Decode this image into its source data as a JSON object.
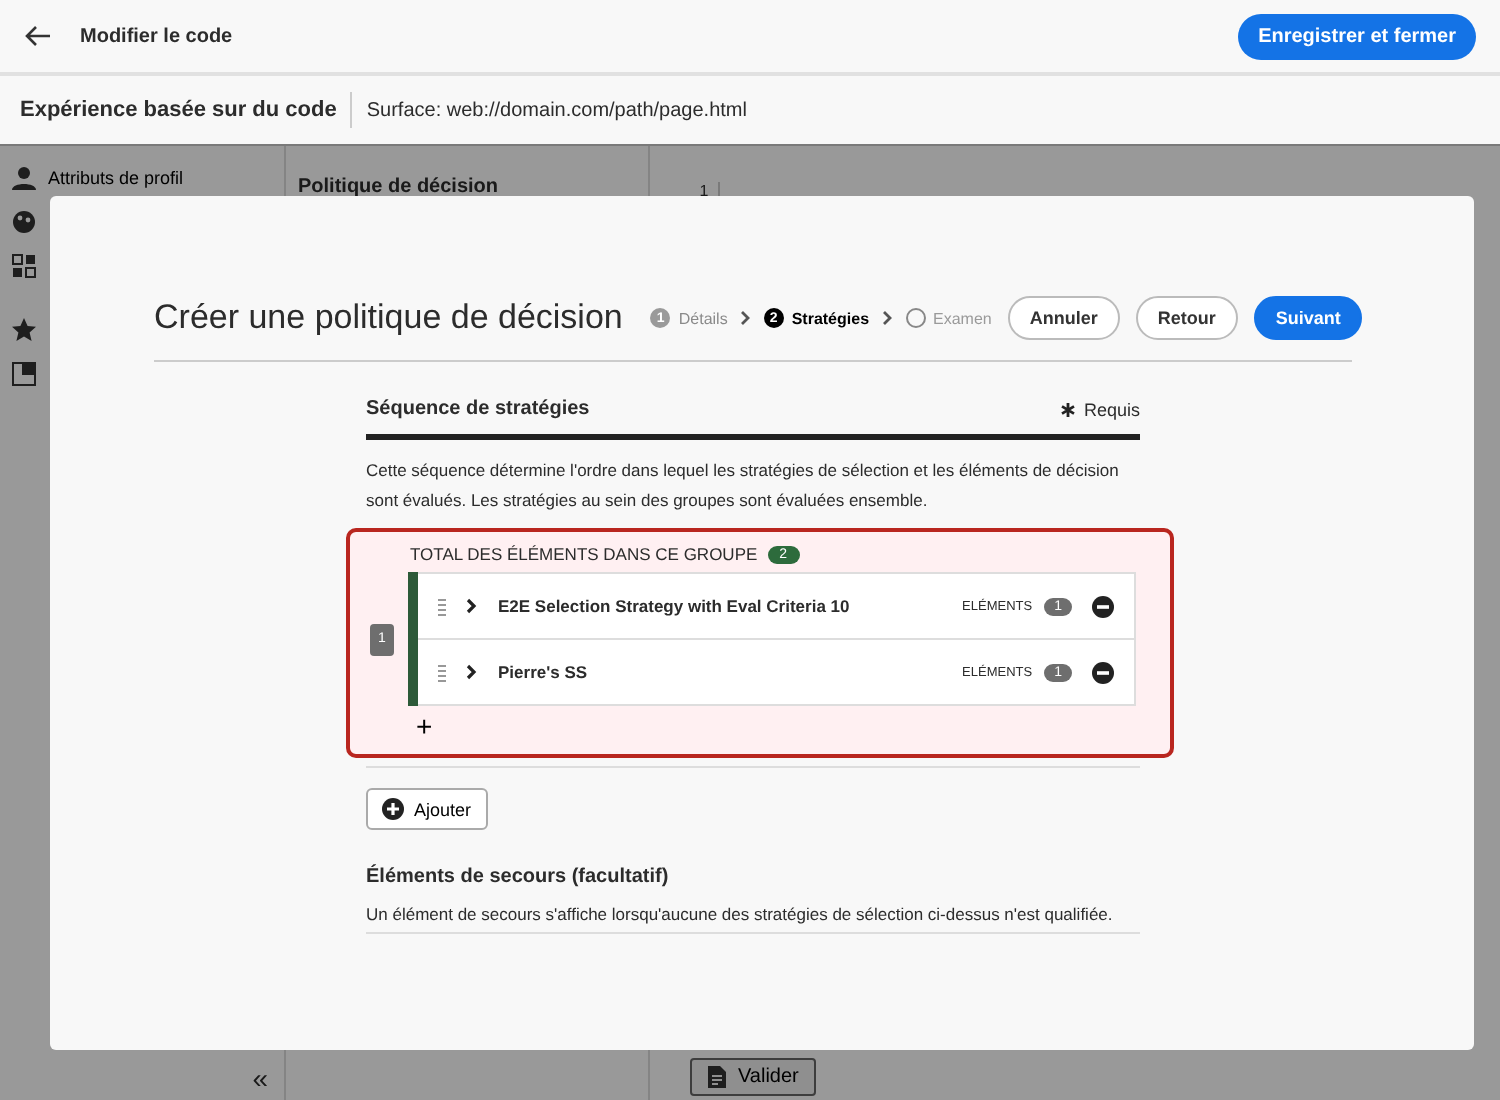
{
  "app_header": {
    "title": "Modifier le code",
    "save_button": "Enregistrer et fermer"
  },
  "subheader": {
    "title": "Expérience basée sur du code",
    "surface": "Surface: web://domain.com/path/page.html"
  },
  "sidebar": {
    "item_label": "Attributs de profil",
    "collapse": "«"
  },
  "decision_panel": {
    "title": "Politique de décision"
  },
  "editor": {
    "line_number": "1",
    "validate_button": "Valider"
  },
  "modal": {
    "title": "Créer une politique de décision",
    "steps": [
      {
        "number": "1",
        "label": "Détails",
        "selected": false
      },
      {
        "number": "2",
        "label": "Stratégies",
        "selected": true
      },
      {
        "label": "Examen",
        "selected": false
      }
    ],
    "buttons": [
      {
        "label": "Annuler",
        "kind": "secondary"
      },
      {
        "label": "Retour",
        "kind": "secondary"
      },
      {
        "label": "Suivant",
        "kind": "primary"
      }
    ],
    "sequence": {
      "title": "Séquence de stratégies",
      "required": "Requis",
      "description": "Cette séquence détermine l'ordre dans lequel les stratégies de sélection et les éléments de décision sont évalués. Les stratégies au sein des groupes sont évaluées ensemble.",
      "group": {
        "selected": true,
        "total_label": "TOTAL DES ÉLÉMENTS DANS CE GROUPE",
        "total_count": "2",
        "number": "1",
        "add": "+",
        "items": [
          {
            "name": "E2E Selection Strategy with Eval Criteria 10",
            "count_label": "ELÉMENTS",
            "count": "1"
          },
          {
            "name": "Pierre's SS",
            "count_label": "ELÉMENTS",
            "count": "1"
          }
        ]
      },
      "add_button": "Ajouter"
    },
    "fallback": {
      "title": "Éléments de secours (facultatif)",
      "description": "Un élément de secours s'affiche lorsqu'aucune des stratégies de sélection ci-dessus n'est qualifiée."
    }
  }
}
